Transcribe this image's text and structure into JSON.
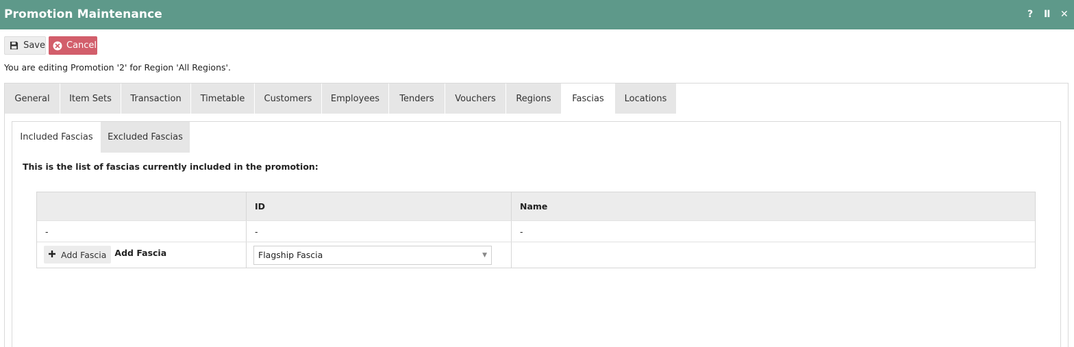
{
  "window": {
    "title": "Promotion Maintenance",
    "controls": [
      {
        "name": "help-icon",
        "glyph": "?"
      },
      {
        "name": "pause-icon",
        "glyph": "II"
      },
      {
        "name": "close-icon",
        "glyph": "✕"
      }
    ]
  },
  "toolbar": {
    "save_label": "Save",
    "cancel_label": "Cancel",
    "save_icon": "floppy-disk-icon",
    "cancel_icon": "cancel-circle-icon",
    "cancel_color": "#d25e6b"
  },
  "status_text": "You are editing Promotion '2' for Region 'All Regions'.",
  "tabs": [
    {
      "label": "General",
      "active": false
    },
    {
      "label": "Item Sets",
      "active": false
    },
    {
      "label": "Transaction",
      "active": false
    },
    {
      "label": "Timetable",
      "active": false
    },
    {
      "label": "Customers",
      "active": false
    },
    {
      "label": "Employees",
      "active": false
    },
    {
      "label": "Tenders",
      "active": false
    },
    {
      "label": "Vouchers",
      "active": false
    },
    {
      "label": "Regions",
      "active": false
    },
    {
      "label": "Fascias",
      "active": true
    },
    {
      "label": "Locations",
      "active": false
    }
  ],
  "subtabs": [
    {
      "label": "Included Fascias",
      "active": true
    },
    {
      "label": "Excluded Fascias",
      "active": false
    }
  ],
  "intro_text": "This is the list of fascias currently included in the promotion:",
  "table": {
    "columns": [
      "",
      "ID",
      "Name"
    ],
    "rows": [
      [
        "-",
        "-",
        "-"
      ]
    ],
    "add_row": {
      "button_label": "Add Fascia",
      "label": "Add Fascia",
      "select_value": "Flagship Fascia"
    }
  },
  "colors": {
    "titlebar": "#5e998a",
    "tab_inactive": "#e6e6e6",
    "header_row": "#ececec"
  }
}
